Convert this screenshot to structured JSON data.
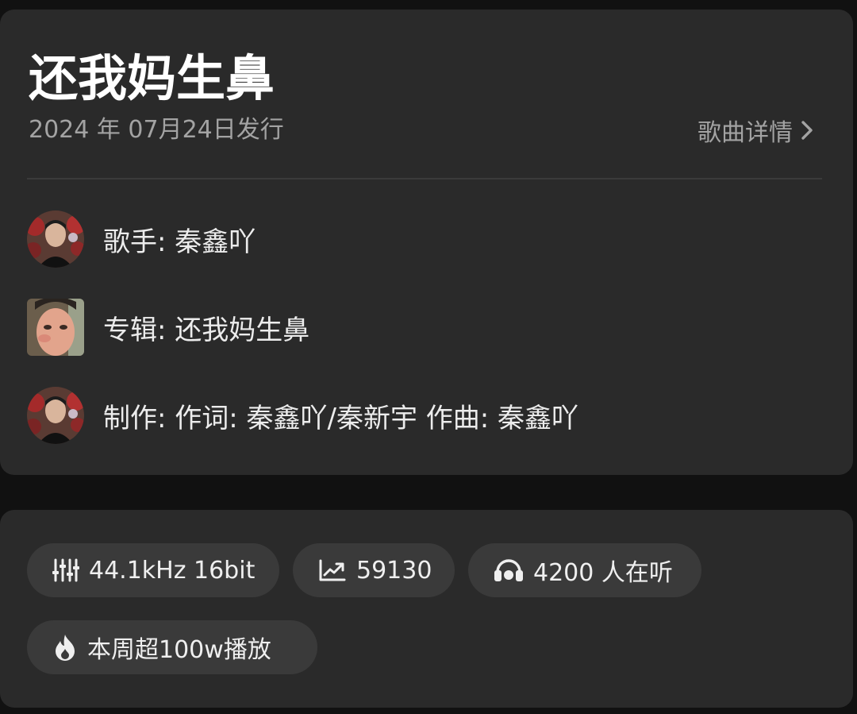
{
  "song": {
    "title": "还我妈生鼻",
    "release_date": "2024 年 07月24日发行",
    "detail_link_label": "歌曲详情"
  },
  "meta": {
    "singer": "歌手: 秦鑫吖",
    "album": "专辑: 还我妈生鼻",
    "credits": "制作: 作词: 秦鑫吖/秦新宇 作曲: 秦鑫吖"
  },
  "stats": {
    "quality": "44.1kHz 16bit",
    "play_count": "59130",
    "listeners": "4200 人在听",
    "weekly": "本周超100w播放"
  },
  "icons": {
    "quality": "equalizer-icon",
    "play_count": "trending-up-icon",
    "listeners": "headphones-icon",
    "weekly": "fire-icon",
    "detail": "chevron-right-icon"
  }
}
